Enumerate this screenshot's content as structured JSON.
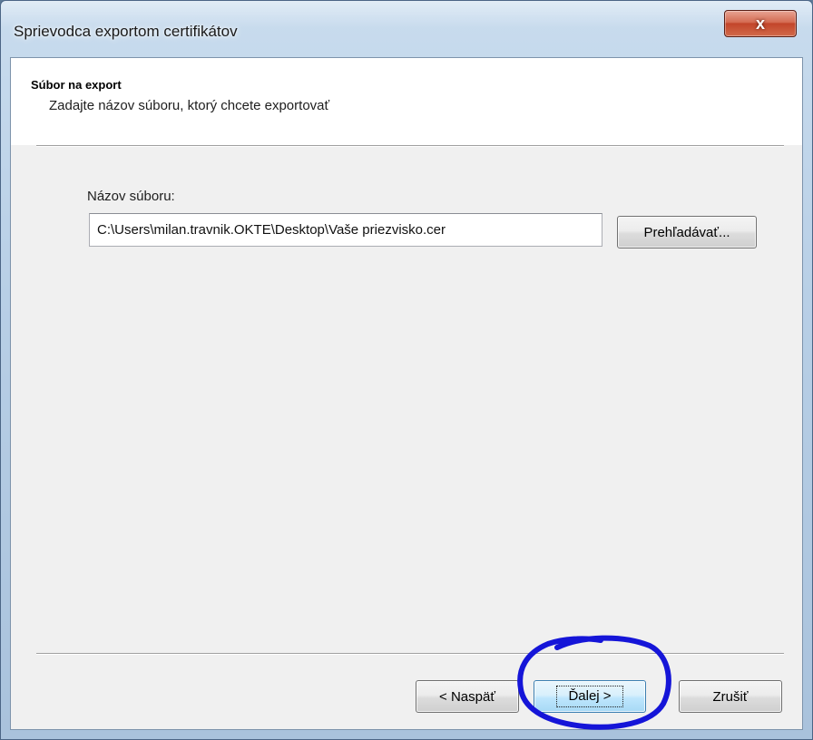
{
  "window": {
    "title": "Sprievodca exportom certifikátov",
    "close_glyph": "x"
  },
  "header": {
    "title": "Súbor na export",
    "subtitle": "Zadajte názov súboru, ktorý chcete exportovať"
  },
  "form": {
    "file_label": "Názov súboru:",
    "file_value": "C:\\Users\\milan.travnik.OKTE\\Desktop\\Vaše priezvisko.cer",
    "browse_label": "Prehľadávať..."
  },
  "footer": {
    "back_label": "< Naspäť",
    "next_label": "Ďalej >",
    "cancel_label": "Zrušiť"
  },
  "annotation": {
    "color": "#1515d8"
  },
  "colors": {
    "titlebar": "#b8cfe6",
    "client_bg": "#f0f0f0",
    "close_button": "#c2452a",
    "default_button": "#bee6fd"
  }
}
